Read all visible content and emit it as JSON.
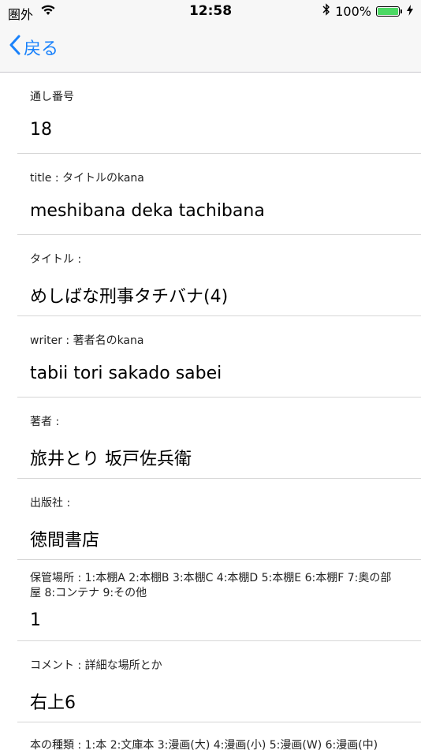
{
  "status": {
    "carrier": "圏外",
    "time": "12:58",
    "battery": "100%"
  },
  "nav": {
    "back_label": "戻る"
  },
  "fields": [
    {
      "label": "通し番号",
      "value": "18"
    },
    {
      "label": "title : タイトルのkana",
      "value": "meshibana deka tachibana"
    },
    {
      "label": "タイトル :",
      "value": "めしばな刑事タチバナ(4)"
    },
    {
      "label": "writer : 著者名のkana",
      "value": "tabii tori sakado sabei"
    },
    {
      "label": "著者 :",
      "value": "旅井とり 坂戸佐兵衛"
    },
    {
      "label": "出版社 :",
      "value": "徳間書店"
    },
    {
      "label": "保管場所 : 1:本棚A 2:本棚B 3:本棚C 4:本棚D 5:本棚E 6:本棚F 7:奥の部屋 8:コンテナ 9:その他",
      "value": "1"
    },
    {
      "label": "コメント : 詳細な場所とか",
      "value": "右上6"
    },
    {
      "label": "本の種類 : 1:本 2:文庫本 3:漫画(大) 4:漫画(小) 5:漫画(W) 6:漫画(中)",
      "value": ""
    }
  ]
}
